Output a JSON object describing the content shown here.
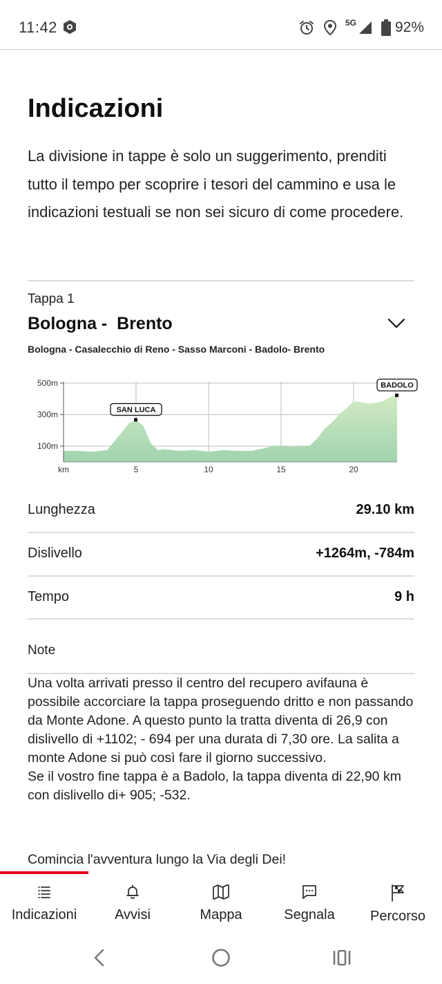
{
  "status_bar": {
    "time": "11:42",
    "network": "5G",
    "battery": "92%"
  },
  "page": {
    "title": "Indicazioni",
    "intro": "La divisione in tappe è solo un suggerimento, prenditi tutto il tempo per scoprire i tesori del cammino e usa le indicazioni testuali se non sei sicuro di come procedere."
  },
  "stage": {
    "label": "Tappa 1",
    "title": "Bologna -  Brento",
    "route": "Bologna - Casalecchio di Reno - Sasso Marconi - Badolo- Brento"
  },
  "chart_data": {
    "type": "area",
    "title": "",
    "xlabel": "km",
    "ylabel": "",
    "x_ticks": [
      "km",
      "5",
      "10",
      "15",
      "20"
    ],
    "y_ticks": [
      "500m",
      "300m",
      "100m"
    ],
    "xlim": [
      0,
      23
    ],
    "ylim": [
      0,
      500
    ],
    "grid": true,
    "color": "#a8d5a6",
    "annotations": [
      {
        "label": "SAN LUCA",
        "x": 5,
        "y": 265
      },
      {
        "label": "BADOLO",
        "x": 23,
        "y": 420
      }
    ],
    "x": [
      0,
      1,
      2,
      3,
      3.5,
      4,
      4.5,
      5,
      5.5,
      6,
      6.5,
      7,
      8,
      9,
      10,
      11,
      12,
      13,
      14,
      14.5,
      15,
      16,
      17,
      17.5,
      18,
      18.5,
      19,
      19.5,
      20,
      20.5,
      21,
      21.5,
      22,
      22.5,
      23
    ],
    "y": [
      70,
      70,
      65,
      75,
      130,
      185,
      245,
      265,
      230,
      120,
      75,
      80,
      70,
      75,
      65,
      75,
      70,
      70,
      90,
      105,
      100,
      95,
      105,
      150,
      210,
      250,
      300,
      340,
      385,
      380,
      370,
      375,
      385,
      410,
      420
    ]
  },
  "stats": [
    {
      "label": "Lunghezza",
      "value": "29.10 km"
    },
    {
      "label": "Dislivello",
      "value": "+1264m, -784m"
    },
    {
      "label": "Tempo",
      "value": "9 h"
    }
  ],
  "notes": {
    "label": "Note",
    "paragraph_1": "Una volta arrivati presso il centro del recupero avifauna è possibile accorciare la tappa proseguendo dritto e non passando da Monte Adone. A questo punto la tratta diventa di 26,9 con dislivello di +1102; - 694 per una durata di 7,30 ore. La salita a monte Adone si può così fare il giorno successivo.",
    "paragraph_2": "Se il vostro fine tappa è a Badolo, la tappa diventa di 22,90 km con dislivello di+ 905; -532.",
    "closing": "Comincia l'avventura lungo la Via degli Dei!"
  },
  "bottom_nav": {
    "items": [
      {
        "label": "Indicazioni",
        "icon": "list-icon",
        "active": true
      },
      {
        "label": "Avvisi",
        "icon": "bell-icon"
      },
      {
        "label": "Mappa",
        "icon": "map-icon"
      },
      {
        "label": "Segnala",
        "icon": "chat-icon"
      },
      {
        "label": "Percorso",
        "icon": "flag-icon"
      }
    ],
    "accent": "#e3001b"
  }
}
